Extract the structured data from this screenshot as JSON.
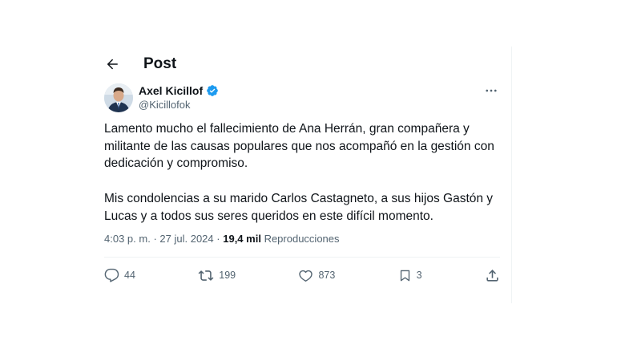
{
  "header": {
    "title": "Post"
  },
  "author": {
    "name": "Axel Kicillof",
    "handle": "@Kicillofok",
    "verified_color": "#1d9bf0"
  },
  "tweet": {
    "paragraphs": [
      "Lamento mucho el fallecimiento de Ana Herrán, gran compañera y militante de las causas populares que nos acompañó en la gestión con dedicación y compromiso.",
      "Mis condolencias a su marido Carlos Castagneto, a sus hijos Gastón y Lucas y a todos sus seres queridos en este difícil momento."
    ]
  },
  "meta": {
    "time": "4:03 p. m.",
    "separator": "·",
    "date": "27 jul. 2024",
    "views_count": "19,4 mil",
    "views_label": "Reproducciones"
  },
  "actions": {
    "replies": "44",
    "reposts": "199",
    "likes": "873",
    "bookmarks": "3"
  },
  "icons": [
    "back-arrow-icon",
    "verified-badge-icon",
    "more-icon",
    "reply-icon",
    "repost-icon",
    "like-icon",
    "bookmark-icon",
    "share-icon"
  ]
}
